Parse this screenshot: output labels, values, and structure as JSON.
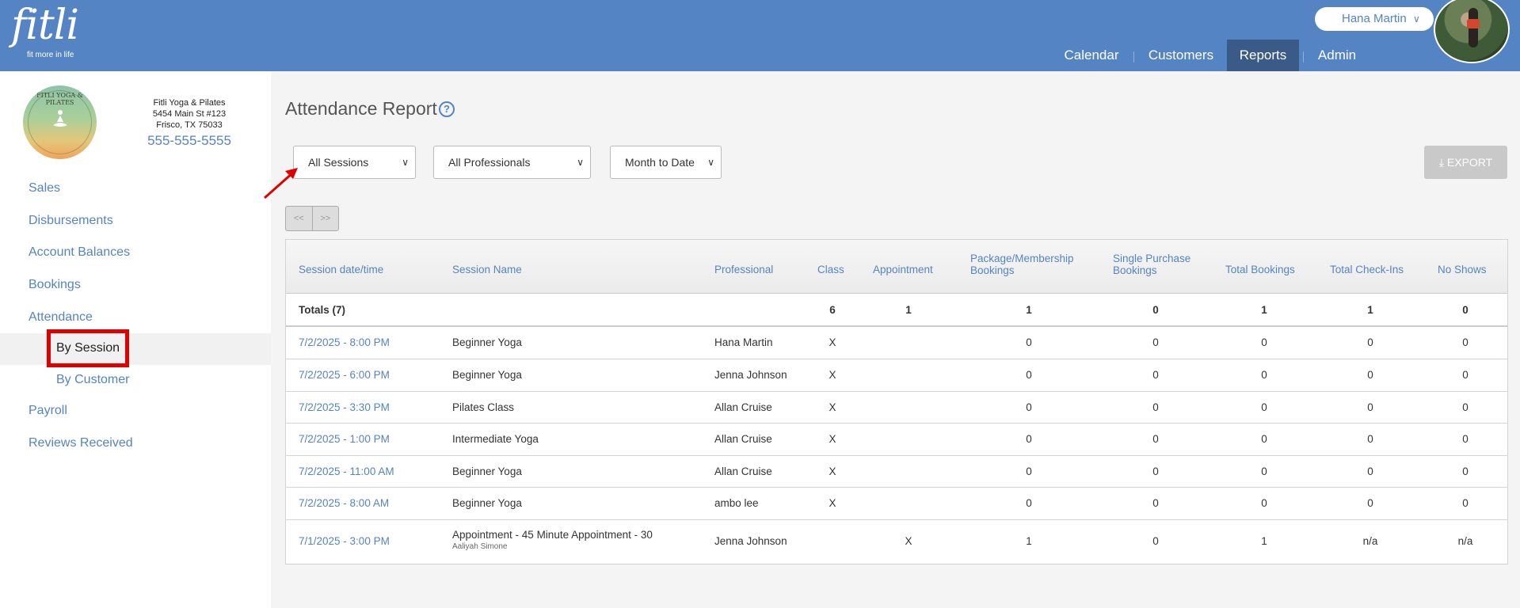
{
  "header": {
    "logo_word": "fitli",
    "logo_tagline": "fit more in life",
    "user_name": "Hana Martin",
    "nav": [
      "Calendar",
      "Customers",
      "Reports",
      "Admin"
    ],
    "nav_active": "Reports",
    "colors": {
      "brand": "#5584c4",
      "nav_active": "#3a5a87"
    }
  },
  "studio": {
    "logo_text": "FITLI YOGA & PILATES",
    "name": "Fitli Yoga & Pilates",
    "address1": "5454 Main St #123",
    "address2": "Frisco, TX 75033",
    "phone": "555-555-5555"
  },
  "sidebar": {
    "items": [
      "Sales",
      "Disbursements",
      "Account Balances",
      "Bookings",
      "Attendance"
    ],
    "sub_items": [
      "By Session",
      "By Customer"
    ],
    "items_after": [
      "Payroll",
      "Reviews Received"
    ],
    "active_sub": "By Session"
  },
  "page": {
    "title": "Attendance Report",
    "help_icon": "?",
    "filters": {
      "sessions": "All Sessions",
      "professionals": "All Professionals",
      "period": "Month to Date"
    },
    "export_label": "EXPORT",
    "pager": [
      "<<",
      ">>"
    ]
  },
  "table": {
    "headers": {
      "date": "Session date/time",
      "name": "Session Name",
      "professional": "Professional",
      "class": "Class",
      "appointment": "Appointment",
      "pkg_line1": "Package/Membership",
      "pkg_line2": "Bookings",
      "single_line1": "Single Purchase",
      "single_line2": "Bookings",
      "total_bookings": "Total Bookings",
      "total_checkins": "Total Check-Ins",
      "no_shows": "No Shows"
    },
    "totals": {
      "label": "Totals (7)",
      "class": "6",
      "appointment": "1",
      "pkg": "1",
      "single": "0",
      "total_bookings": "1",
      "total_checkins": "1",
      "no_shows": "0"
    },
    "rows": [
      {
        "date": "7/2/2025 - 8:00 PM",
        "name": "Beginner Yoga",
        "professional": "Hana Martin",
        "class": "X",
        "appointment": "",
        "pkg": "0",
        "single": "0",
        "total_bookings": "0",
        "total_checkins": "0",
        "no_shows": "0"
      },
      {
        "date": "7/2/2025 - 6:00 PM",
        "name": "Beginner Yoga",
        "professional": "Jenna Johnson",
        "class": "X",
        "appointment": "",
        "pkg": "0",
        "single": "0",
        "total_bookings": "0",
        "total_checkins": "0",
        "no_shows": "0"
      },
      {
        "date": "7/2/2025 - 3:30 PM",
        "name": "Pilates Class",
        "professional": "Allan Cruise",
        "class": "X",
        "appointment": "",
        "pkg": "0",
        "single": "0",
        "total_bookings": "0",
        "total_checkins": "0",
        "no_shows": "0"
      },
      {
        "date": "7/2/2025 - 1:00 PM",
        "name": "Intermediate Yoga",
        "professional": "Allan Cruise",
        "class": "X",
        "appointment": "",
        "pkg": "0",
        "single": "0",
        "total_bookings": "0",
        "total_checkins": "0",
        "no_shows": "0"
      },
      {
        "date": "7/2/2025 - 11:00 AM",
        "name": "Beginner Yoga",
        "professional": "Allan Cruise",
        "class": "X",
        "appointment": "",
        "pkg": "0",
        "single": "0",
        "total_bookings": "0",
        "total_checkins": "0",
        "no_shows": "0"
      },
      {
        "date": "7/2/2025 - 8:00 AM",
        "name": "Beginner Yoga",
        "professional": "ambo lee",
        "class": "X",
        "appointment": "",
        "pkg": "0",
        "single": "0",
        "total_bookings": "0",
        "total_checkins": "0",
        "no_shows": "0"
      },
      {
        "date": "7/1/2025 - 3:00 PM",
        "name": "Appointment - 45 Minute Appointment - 30",
        "subname": "Aaliyah Simone",
        "professional": "Jenna Johnson",
        "class": "",
        "appointment": "X",
        "pkg": "1",
        "single": "0",
        "total_bookings": "1",
        "total_checkins": "n/a",
        "no_shows": "n/a"
      }
    ]
  }
}
